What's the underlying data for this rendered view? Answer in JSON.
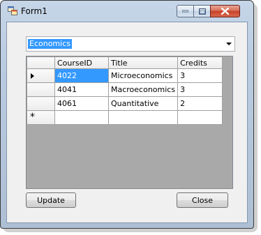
{
  "window": {
    "title": "Form1"
  },
  "controls": {
    "minimize_icon": "minimize-icon",
    "maximize_icon": "maximize-icon",
    "close_icon": "close-x-icon"
  },
  "combo": {
    "value": "Economics"
  },
  "grid": {
    "columns": [
      "CourseID",
      "Title",
      "Credits"
    ],
    "rows": [
      {
        "CourseID": "4022",
        "Title": "Microeconomics",
        "Credits": "3"
      },
      {
        "CourseID": "4041",
        "Title": "Macroeconomics",
        "Credits": "3"
      },
      {
        "CourseID": "4061",
        "Title": "Quantitative",
        "Credits": "2"
      }
    ],
    "new_row_marker": "*",
    "selection_color": "#3399ff"
  },
  "buttons": {
    "update_label": "Update",
    "close_label": "Close"
  }
}
